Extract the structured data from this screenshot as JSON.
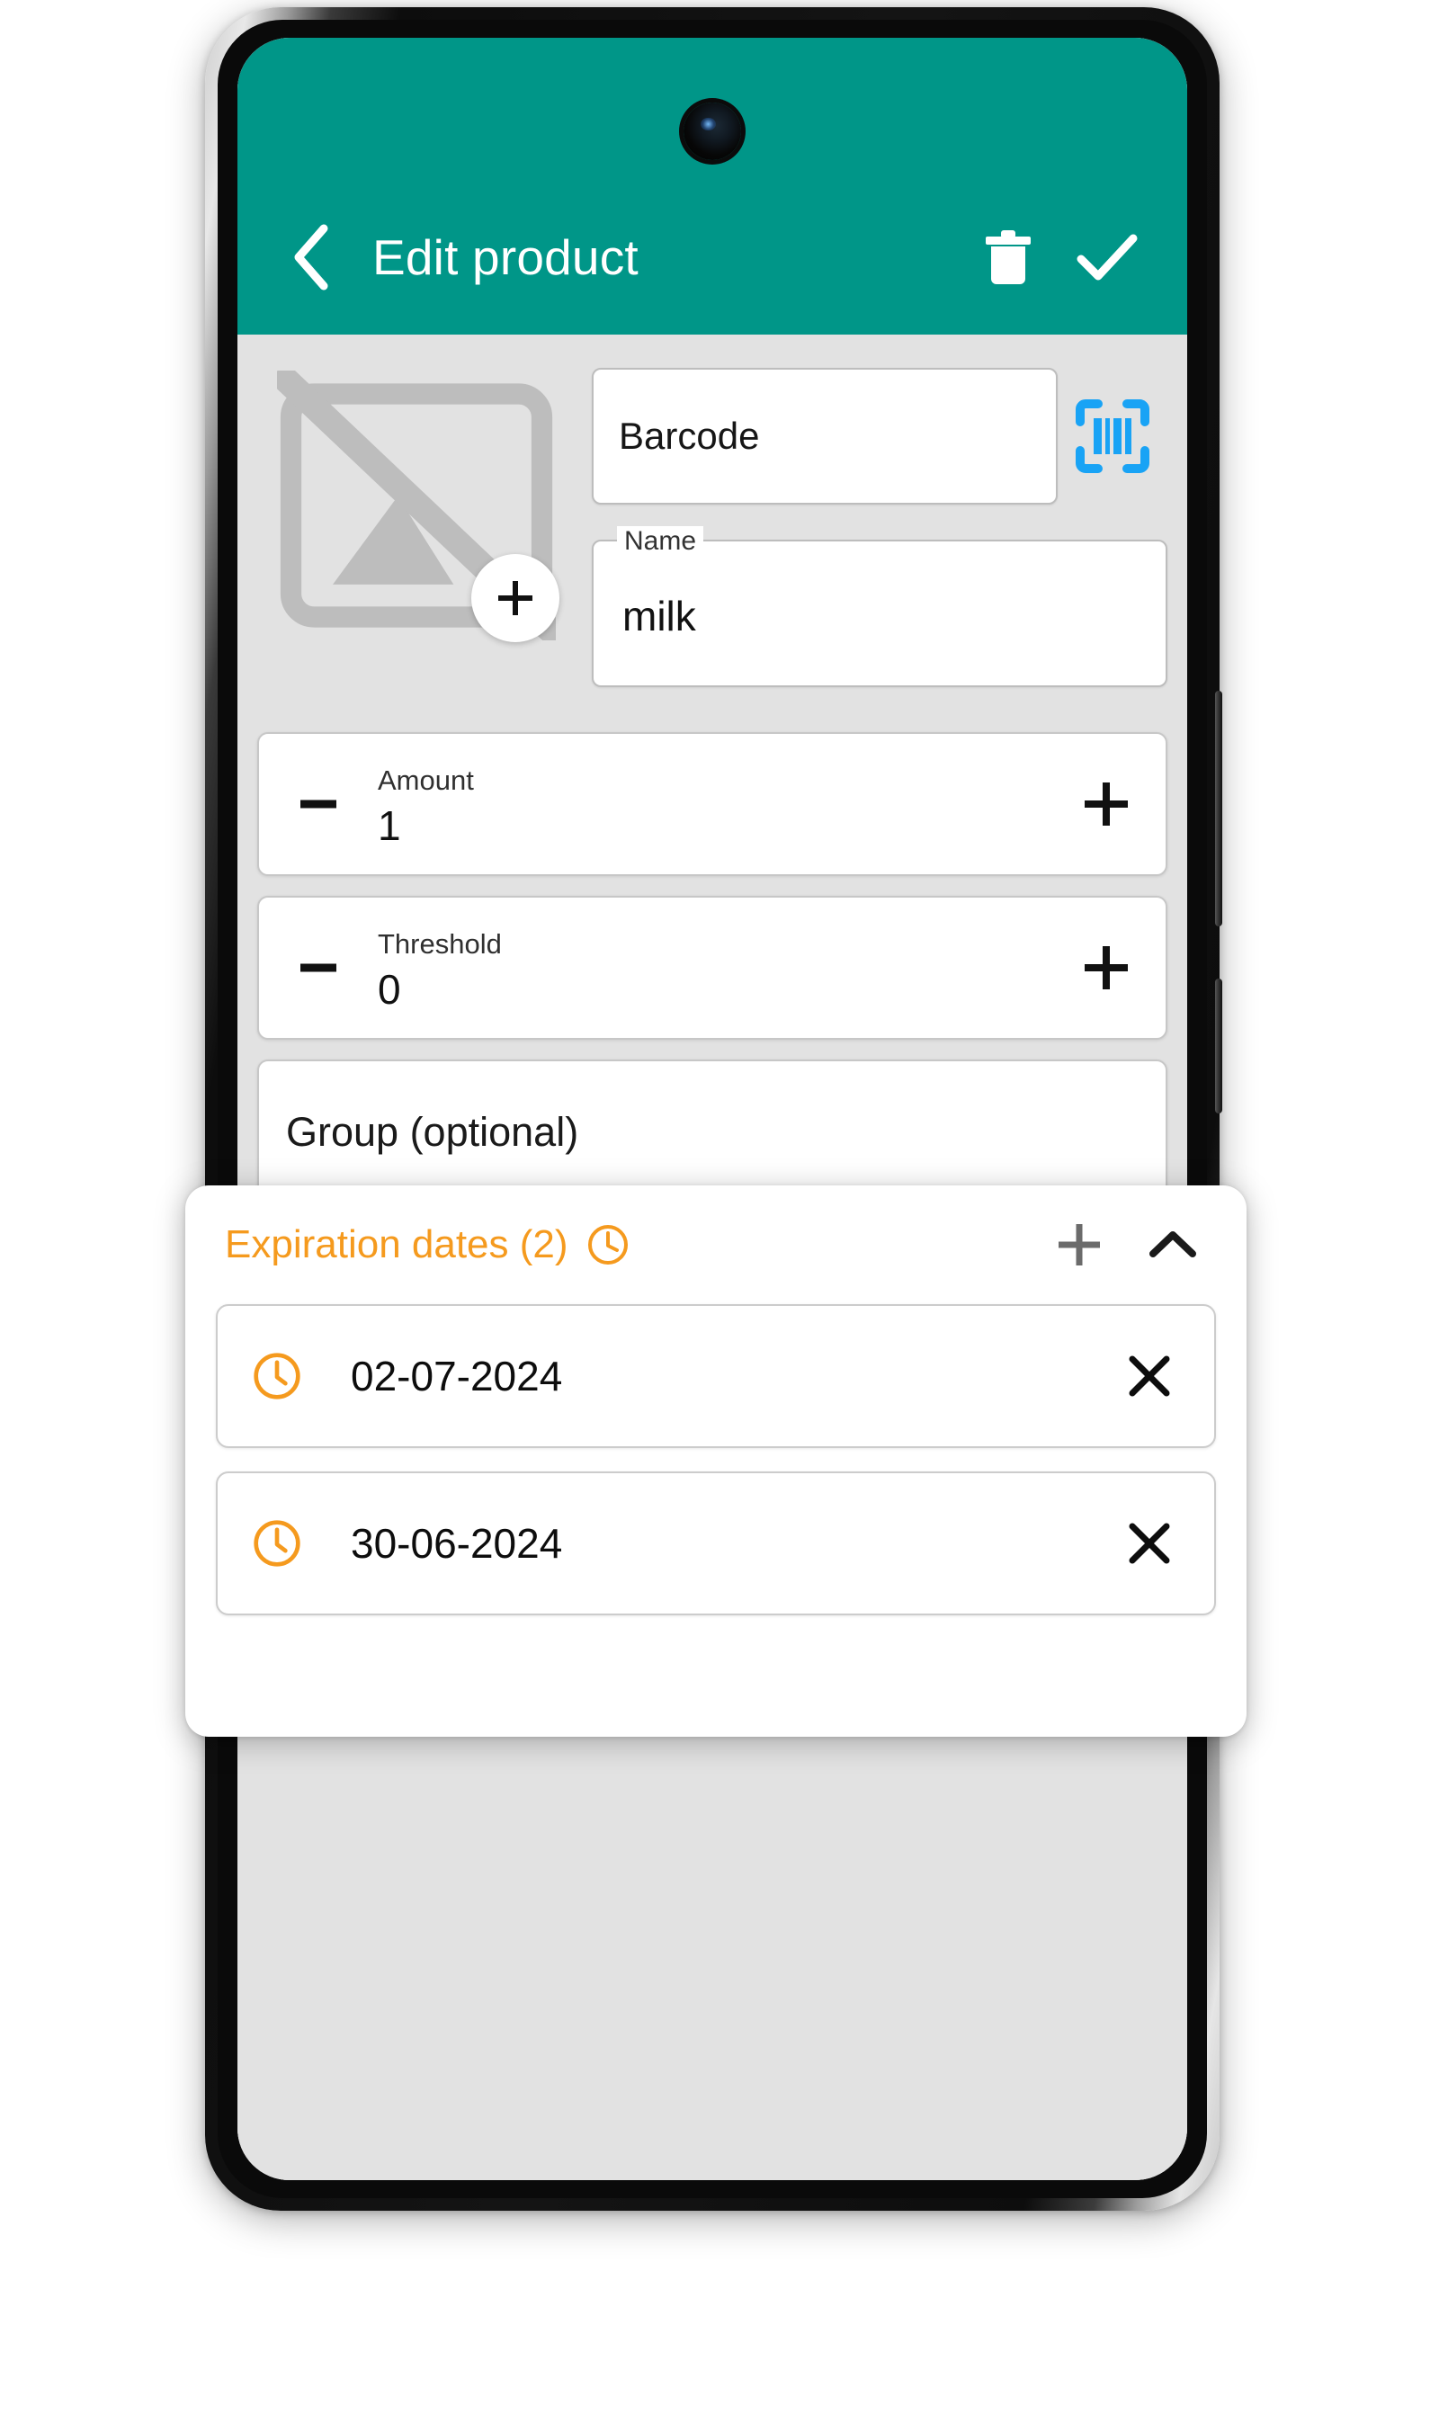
{
  "appbar": {
    "back_icon": "chevron-left-icon",
    "title": "Edit product",
    "delete_icon": "trash-icon",
    "confirm_icon": "check-icon"
  },
  "product": {
    "image_placeholder_icon": "image-off-icon",
    "add_photo_label": "+",
    "barcode": {
      "placeholder": "Barcode",
      "value": "",
      "scan_icon": "barcode-scan-icon",
      "scan_color": "#19A3F5"
    },
    "name": {
      "label": "Name",
      "value": "milk"
    },
    "amount": {
      "label": "Amount",
      "value": "1",
      "decrement_label": "−",
      "increment_label": "+"
    },
    "threshold": {
      "label": "Threshold",
      "value": "0",
      "decrement_label": "−",
      "increment_label": "+"
    },
    "group": {
      "placeholder": "Group (optional)",
      "value": ""
    }
  },
  "expiration": {
    "title": "Expiration dates (2)",
    "clock_icon": "clock-icon",
    "accent_color": "#F59A1E",
    "add_icon": "plus-icon",
    "collapse_icon": "chevron-up-icon",
    "items": [
      {
        "date": "02-07-2024",
        "clock_icon": "clock-icon",
        "remove_icon": "close-icon"
      },
      {
        "date": "30-06-2024",
        "clock_icon": "clock-icon",
        "remove_icon": "close-icon"
      }
    ]
  },
  "theme": {
    "appbar_color": "#009688",
    "screen_background": "#e2e2e2"
  }
}
